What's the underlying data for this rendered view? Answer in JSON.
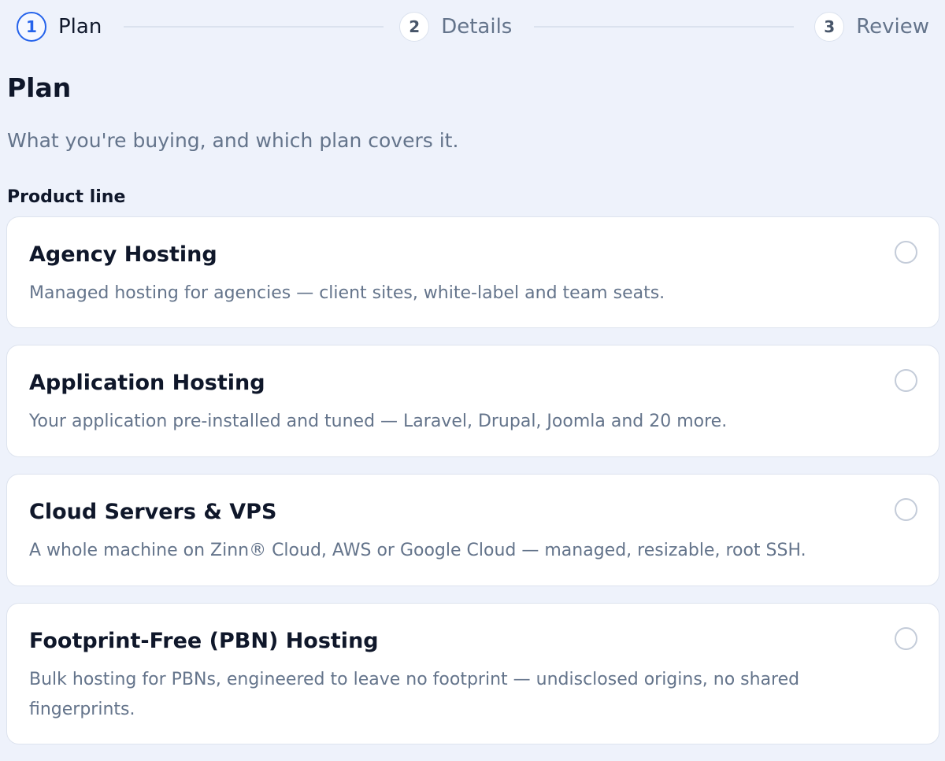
{
  "stepper": {
    "steps": [
      {
        "number": "1",
        "label": "Plan",
        "state": "active"
      },
      {
        "number": "2",
        "label": "Details",
        "state": "upcoming"
      },
      {
        "number": "3",
        "label": "Review",
        "state": "upcoming"
      }
    ]
  },
  "page": {
    "title": "Plan",
    "subtitle": "What you're buying, and which plan covers it."
  },
  "product_line": {
    "label": "Product line",
    "selected": null,
    "options": [
      {
        "title": "Agency Hosting",
        "description": "Managed hosting for agencies — client sites, white-label and team seats."
      },
      {
        "title": "Application Hosting",
        "description": "Your application pre-installed and tuned — Laravel, Drupal, Joomla and 20 more."
      },
      {
        "title": "Cloud Servers & VPS",
        "description": "A whole machine on Zinn® Cloud, AWS or Google Cloud — managed, resizable, root SSH."
      },
      {
        "title": "Footprint-Free (PBN) Hosting",
        "description": "Bulk hosting for PBNs, engineered to leave no footprint — undisclosed origins, no shared fingerprints."
      }
    ]
  },
  "colors": {
    "background": "#eef2fb",
    "accent": "#2563eb",
    "text_primary": "#0f172a",
    "text_muted": "#64748b",
    "card_border": "#dde3ee"
  }
}
